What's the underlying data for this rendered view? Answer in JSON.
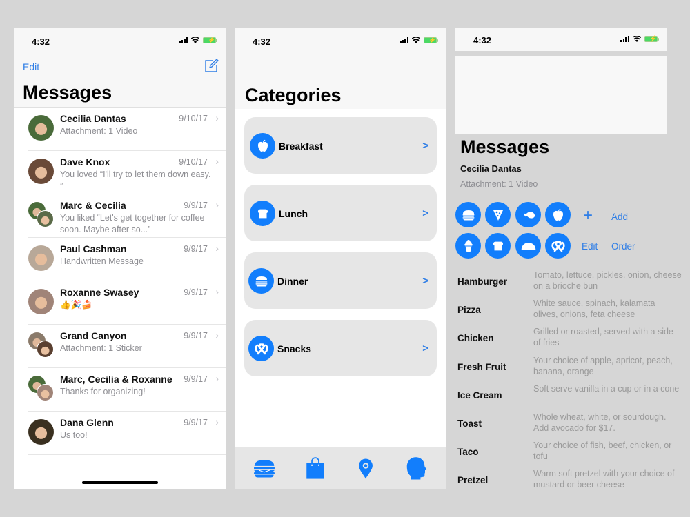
{
  "status": {
    "time": "4:32"
  },
  "messages_screen": {
    "edit_label": "Edit",
    "title": "Messages",
    "conversations": [
      {
        "name": "Cecilia Dantas",
        "date": "9/10/17",
        "preview": "Attachment: 1 Video",
        "group": false,
        "colors": [
          "#4a6b3a"
        ]
      },
      {
        "name": "Dave Knox",
        "date": "9/10/17",
        "preview": "You loved “I'll try to let them down easy. ”",
        "group": false,
        "colors": [
          "#6a4a38"
        ]
      },
      {
        "name": "Marc & Cecilia",
        "date": "9/9/17",
        "preview": "You liked “Let's get together for coffee soon. Maybe after so...”",
        "group": true,
        "colors": [
          "#4a6b3a",
          "#5a6a48"
        ]
      },
      {
        "name": "Paul Cashman",
        "date": "9/9/17",
        "preview": "Handwritten Message",
        "group": false,
        "colors": [
          "#b8a898"
        ]
      },
      {
        "name": "Roxanne Swasey",
        "date": "9/9/17",
        "preview": "👍🎉🍰",
        "group": false,
        "colors": [
          "#a08478"
        ]
      },
      {
        "name": "Grand Canyon",
        "date": "9/9/17",
        "preview": "Attachment: 1 Sticker",
        "group": true,
        "colors": [
          "#8a7a6a",
          "#5a4030"
        ]
      },
      {
        "name": "Marc, Cecilia & Roxanne",
        "date": "9/9/17",
        "preview": "Thanks for organizing!",
        "group": true,
        "colors": [
          "#4a6b3a",
          "#a08478"
        ]
      },
      {
        "name": "Dana Glenn",
        "date": "9/9/17",
        "preview": "Us too!",
        "group": false,
        "colors": [
          "#3a3020"
        ]
      }
    ]
  },
  "categories_screen": {
    "title": "Categories",
    "categories": [
      {
        "label": "Breakfast",
        "icon": "apple-icon",
        "arrow": ">"
      },
      {
        "label": "Lunch",
        "icon": "toast-icon",
        "arrow": ">"
      },
      {
        "label": "Dinner",
        "icon": "hamburger-icon",
        "arrow": ">"
      },
      {
        "label": "Snacks",
        "icon": "pretzel-icon",
        "arrow": ">"
      }
    ],
    "tabs": [
      "hamburger-icon",
      "shopping-bag-icon",
      "location-pin-icon",
      "profile-head-icon"
    ]
  },
  "menu_screen": {
    "title": "Messages",
    "contact_name": "Cecilia Dantas",
    "contact_preview": "Attachment: 1 Video",
    "add_label": "Add",
    "edit_label": "Edit",
    "order_label": "Order",
    "plus_glyph": "+",
    "food_icons": [
      "hamburger-icon",
      "pizza-icon",
      "chicken-icon",
      "apple-icon",
      "ice-cream-icon",
      "toast-icon",
      "taco-icon",
      "pretzel-icon"
    ],
    "items": [
      {
        "name": "Hamburger",
        "desc": "Tomato, lettuce, pickles, onion, cheese on a brioche bun"
      },
      {
        "name": "Pizza",
        "desc": "White sauce, spinach, kalamata olives, onions, feta cheese"
      },
      {
        "name": "Chicken",
        "desc": "Grilled or roasted, served with a side of fries"
      },
      {
        "name": "Fresh Fruit",
        "desc": "Your choice of apple, apricot, peach, banana, orange"
      },
      {
        "name": "Ice Cream",
        "desc": "Soft serve vanilla in a cup or in a cone"
      },
      {
        "name": "Toast",
        "desc": "Whole wheat, white, or sourdough. Add avocado for $17."
      },
      {
        "name": "Taco",
        "desc": "Your choice of fish, beef, chicken, or tofu"
      },
      {
        "name": "Pretzel",
        "desc": "Warm soft pretzel with your choice of mustard or beer cheese"
      }
    ]
  },
  "colors": {
    "accent": "#127efc",
    "link": "#2f7ee6",
    "card": "#e6e6e6",
    "backdrop": "#d6d6d6"
  }
}
